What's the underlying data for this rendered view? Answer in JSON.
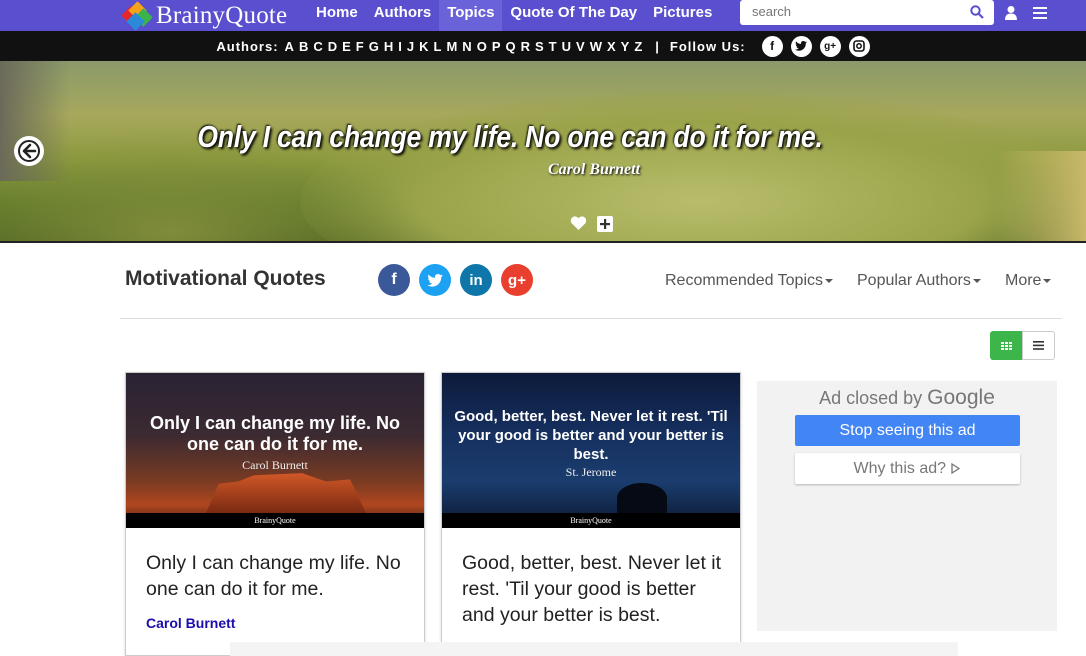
{
  "nav": {
    "logo": "BrainyQuote",
    "links": [
      "Home",
      "Authors",
      "Topics",
      "Quote Of The Day",
      "Pictures"
    ],
    "active": "Topics",
    "search_placeholder": "search"
  },
  "alphabet": {
    "label": "Authors:",
    "letters": [
      "A",
      "B",
      "C",
      "D",
      "E",
      "F",
      "G",
      "H",
      "I",
      "J",
      "K",
      "L",
      "M",
      "N",
      "O",
      "P",
      "Q",
      "R",
      "S",
      "T",
      "U",
      "V",
      "W",
      "X",
      "Y",
      "Z"
    ],
    "separator": "|",
    "follow_label": "Follow Us:"
  },
  "hero": {
    "quote": "Only I can change my life. No one can do it for me.",
    "author": "Carol Burnett"
  },
  "page": {
    "title": "Motivational Quotes",
    "menu": [
      "Recommended Topics",
      "Popular Authors",
      "More"
    ]
  },
  "cards": [
    {
      "image_text": "Only I can change my life. No one can do it for me.",
      "image_author": "Carol Burnett",
      "brand": "BrainyQuote",
      "quote": "Only I can change my life. No one can do it for me.",
      "author": "Carol Burnett"
    },
    {
      "image_text": "Good, better, best. Never let it rest. 'Til your good is better and your better is best.",
      "image_author": "St. Jerome",
      "brand": "BrainyQuote",
      "quote": "Good, better, best. Never let it rest. 'Til your good is better and your better is best.",
      "author": ""
    }
  ],
  "ad": {
    "closed_by": "Ad closed by",
    "google": "Google",
    "stop": "Stop seeing this ad",
    "why": "Why this ad?"
  },
  "colors": {
    "nav_bg": "#5a4fcf",
    "author_link": "#1a0dab",
    "grid_active": "#3cb54a",
    "ad_button": "#4285f4"
  }
}
